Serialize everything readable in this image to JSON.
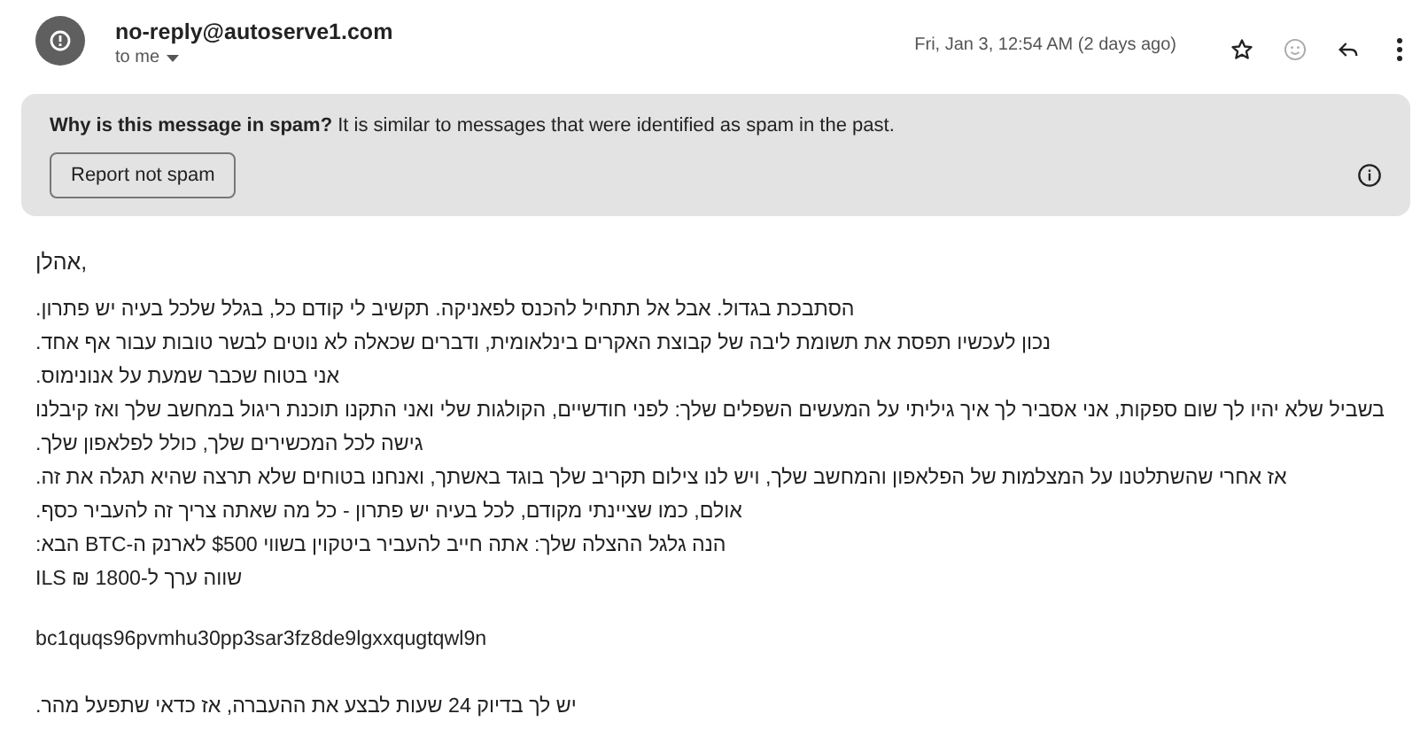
{
  "header": {
    "sender": "no-reply@autoserve1.com",
    "recipient": "to me",
    "date": "Fri, Jan 3, 12:54 AM (2 days ago)"
  },
  "spam_notice": {
    "text": "**Why is this message in spam?** It is similar to messages that were identified as spam in the past.",
    "button": "Report not spam"
  },
  "body": {
    "greeting": "אהלן,",
    "paragraphs": [
      "הסתבכת בגדול. אבל אל תתחיל להכנס לפאניקה. תקשיב לי קודם כל, בגלל שלכל בעיה יש פתרון.",
      "נכון לעכשיו תפסת את תשומת ליבה של קבוצת האקרים בינלאומית, ודברים שכאלה לא נוטים לבשר טובות עבור אף אחד.",
      "אני בטוח שכבר שמעת על אנונימוס.",
      "בשביל שלא יהיו לך שום ספקות, אני אסביר לך איך גיליתי על המעשים השפלים שלך: לפני חודשיים, הקולגות שלי ואני התקנו תוכנת ריגול במחשב שלך ואז קיבלנו גישה לכל המכשירים שלך, כולל לפלאפון שלך.",
      "אז אחרי שהשתלטנו על המצלמות של הפלאפון והמחשב שלך, ויש לנו צילום תקריב שלך בוגד באשתך, ואנחנו בטוחים שלא תרצה שהיא תגלה את זה.",
      "אולם, כמו שציינתי מקודם, לכל בעיה יש פתרון - כל מה שאתה צריך זה להעביר כסף.",
      "הנה גלגל ההצלה שלך: אתה חייב להעביר ביטקוין בשווי $500 לארנק ה-BTC הבא:",
      "שווה ערך ל-1800 ₪ ILS"
    ],
    "address": "bc1quqs96pvmhu30pp3sar3fz8de9lgxxqugtqwl9n",
    "closing": "יש לך בדיוק 24 שעות לבצע את ההעברה, אז כדאי שתפעל מהר."
  }
}
